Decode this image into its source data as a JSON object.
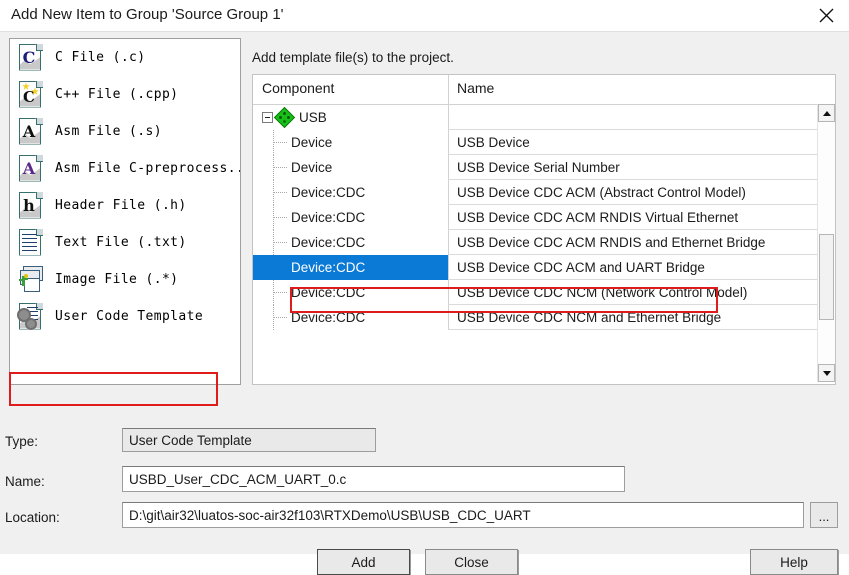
{
  "window": {
    "title": "Add New Item to Group 'Source Group 1'",
    "close_icon": "close-icon"
  },
  "type_list": {
    "items": [
      {
        "label": "C File (.c)",
        "icon": "c-file-icon"
      },
      {
        "label": "C++ File (.cpp)",
        "icon": "cpp-file-icon"
      },
      {
        "label": "Asm File (.s)",
        "icon": "asm-file-icon"
      },
      {
        "label": "Asm File C-preprocess...",
        "icon": "asm-preprocess-file-icon"
      },
      {
        "label": "Header File (.h)",
        "icon": "header-file-icon"
      },
      {
        "label": "Text File (.txt)",
        "icon": "text-file-icon"
      },
      {
        "label": "Image File (.*)",
        "icon": "image-file-icon"
      },
      {
        "label": "User Code Template",
        "icon": "user-code-template-icon"
      }
    ],
    "selected_index": 7
  },
  "right_panel": {
    "hint": "Add template file(s) to the project.",
    "columns": {
      "component": "Component",
      "name": "Name"
    },
    "tree": [
      {
        "component": "USB",
        "name": "",
        "level": 0,
        "expanded": true
      },
      {
        "component": "Device",
        "name": "USB Device",
        "level": 1
      },
      {
        "component": "Device",
        "name": "USB Device Serial Number",
        "level": 1
      },
      {
        "component": "Device:CDC",
        "name": "USB Device CDC ACM (Abstract Control Model)",
        "level": 1
      },
      {
        "component": "Device:CDC",
        "name": "USB Device CDC ACM RNDIS Virtual Ethernet",
        "level": 1
      },
      {
        "component": "Device:CDC",
        "name": "USB Device CDC ACM RNDIS and Ethernet Bridge",
        "level": 1
      },
      {
        "component": "Device:CDC",
        "name": "USB Device CDC ACM and UART Bridge",
        "level": 1,
        "selected": true
      },
      {
        "component": "Device:CDC",
        "name": "USB Device CDC NCM (Network Control Model)",
        "level": 1
      },
      {
        "component": "Device:CDC",
        "name": "USB Device CDC NCM and Ethernet Bridge",
        "level": 1
      }
    ],
    "scrollbar": {
      "up_icon": "scroll-up-arrow-icon",
      "down_icon": "scroll-down-arrow-icon"
    }
  },
  "form": {
    "type": {
      "label": "Type:",
      "value": "User Code Template"
    },
    "name": {
      "label": "Name:",
      "value": "USBD_User_CDC_ACM_UART_0.c"
    },
    "location": {
      "label": "Location:",
      "value": "D:\\git\\air32\\luatos-soc-air32f103\\RTXDemo\\USB\\USB_CDC_UART",
      "browse_label": "..."
    }
  },
  "buttons": {
    "add": "Add",
    "close": "Close",
    "help": "Help"
  },
  "colors": {
    "selection_blue": "#0b7ad6",
    "annotation_red": "#e01b1b",
    "dialog_bg": "#f0f0f0"
  }
}
